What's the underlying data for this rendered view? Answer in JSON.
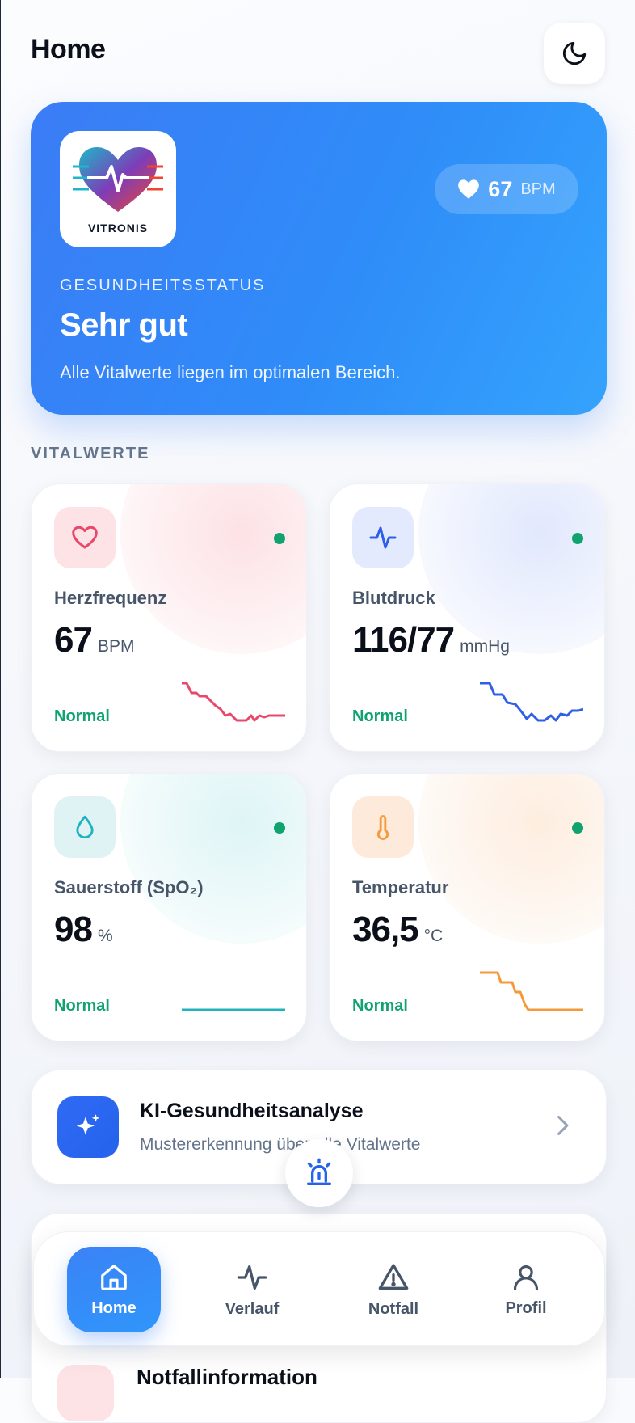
{
  "header": {
    "title": "Home",
    "theme_icon": "moon-icon"
  },
  "hero": {
    "logo_text": "VITRONIS",
    "bpm_value": "67",
    "bpm_unit": "BPM",
    "label": "GESUNDHEITSSTATUS",
    "status": "Sehr gut",
    "description": "Alle Vitalwerte liegen im optimalen Bereich."
  },
  "vitals_section": {
    "label": "VITALWERTE"
  },
  "vitals": [
    {
      "name": "Herzfrequenz",
      "value": "67",
      "unit": "BPM",
      "state": "Normal",
      "icon": "heart-icon",
      "color": "#e8496a"
    },
    {
      "name": "Blutdruck",
      "value": "116/77",
      "unit": "mmHg",
      "state": "Normal",
      "icon": "activity-icon",
      "color": "#2f5fe8"
    },
    {
      "name": "Sauerstoff (SpO₂)",
      "value": "98",
      "unit": "%",
      "state": "Normal",
      "icon": "droplet-icon",
      "color": "#1fb3bf"
    },
    {
      "name": "Temperatur",
      "value": "36,5",
      "unit": "°C",
      "state": "Normal",
      "icon": "thermometer-icon",
      "color": "#f59a3b"
    }
  ],
  "ai_card": {
    "title": "KI-Gesundheitsanalyse",
    "subtitle": "Mustererkennung über alle Vitalwerte",
    "icon": "sparkles-icon"
  },
  "emergency_fab": {
    "icon": "siren-icon"
  },
  "peek_card": {
    "title": "Notfallinformation"
  },
  "nav": {
    "items": [
      {
        "label": "Home",
        "icon": "home-icon",
        "active": true
      },
      {
        "label": "Verlauf",
        "icon": "activity-icon",
        "active": false
      },
      {
        "label": "Notfall",
        "icon": "alert-triangle-icon",
        "active": false
      },
      {
        "label": "Profil",
        "icon": "user-icon",
        "active": false
      }
    ]
  },
  "colors": {
    "accent": "#3b82f6",
    "normal": "#11a36f"
  }
}
